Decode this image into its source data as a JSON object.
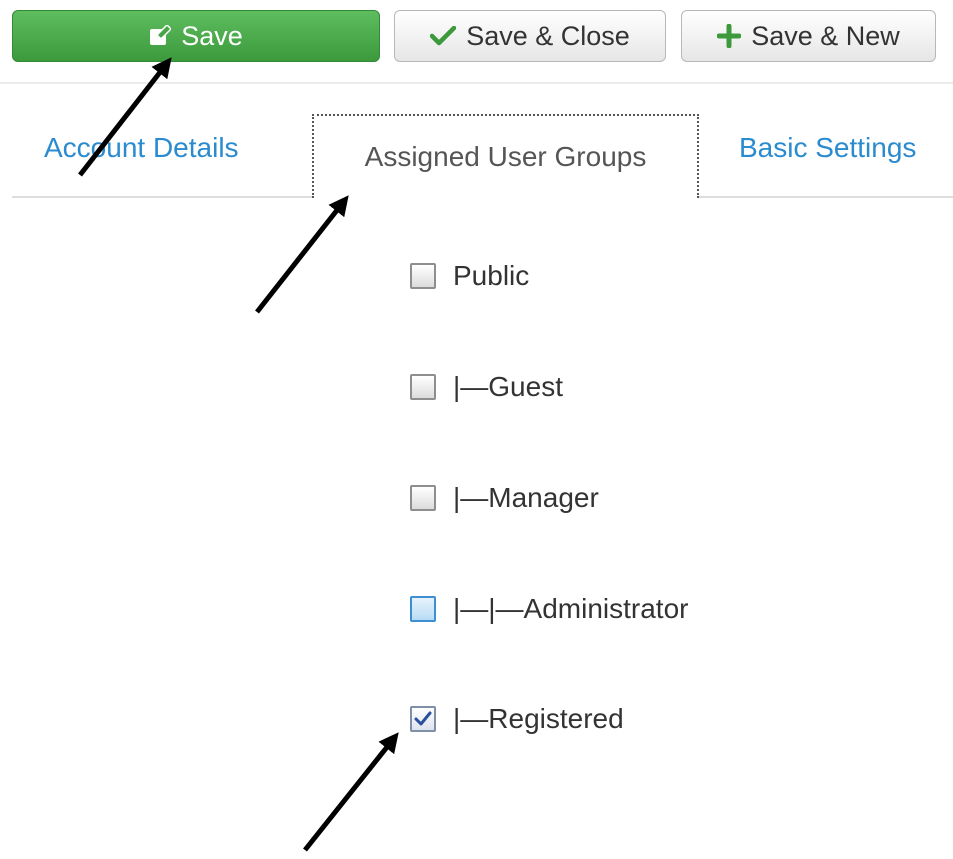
{
  "toolbar": {
    "save_label": "Save",
    "save_close_label": "Save & Close",
    "save_new_label": "Save & New",
    "save_color": "#46a546"
  },
  "tabs": {
    "items": [
      {
        "label": "Account Details"
      },
      {
        "label": "Assigned User Groups",
        "active": true
      },
      {
        "label": "Basic Settings"
      }
    ],
    "link_color": "#2a8bcf"
  },
  "groups": [
    {
      "label": "Public",
      "checked": false
    },
    {
      "label": "|—Guest",
      "checked": false
    },
    {
      "label": "|—Manager",
      "checked": false
    },
    {
      "label": "|—|—Administrator",
      "checked": false,
      "hovered": true
    },
    {
      "label": "|—Registered",
      "checked": true
    }
  ]
}
